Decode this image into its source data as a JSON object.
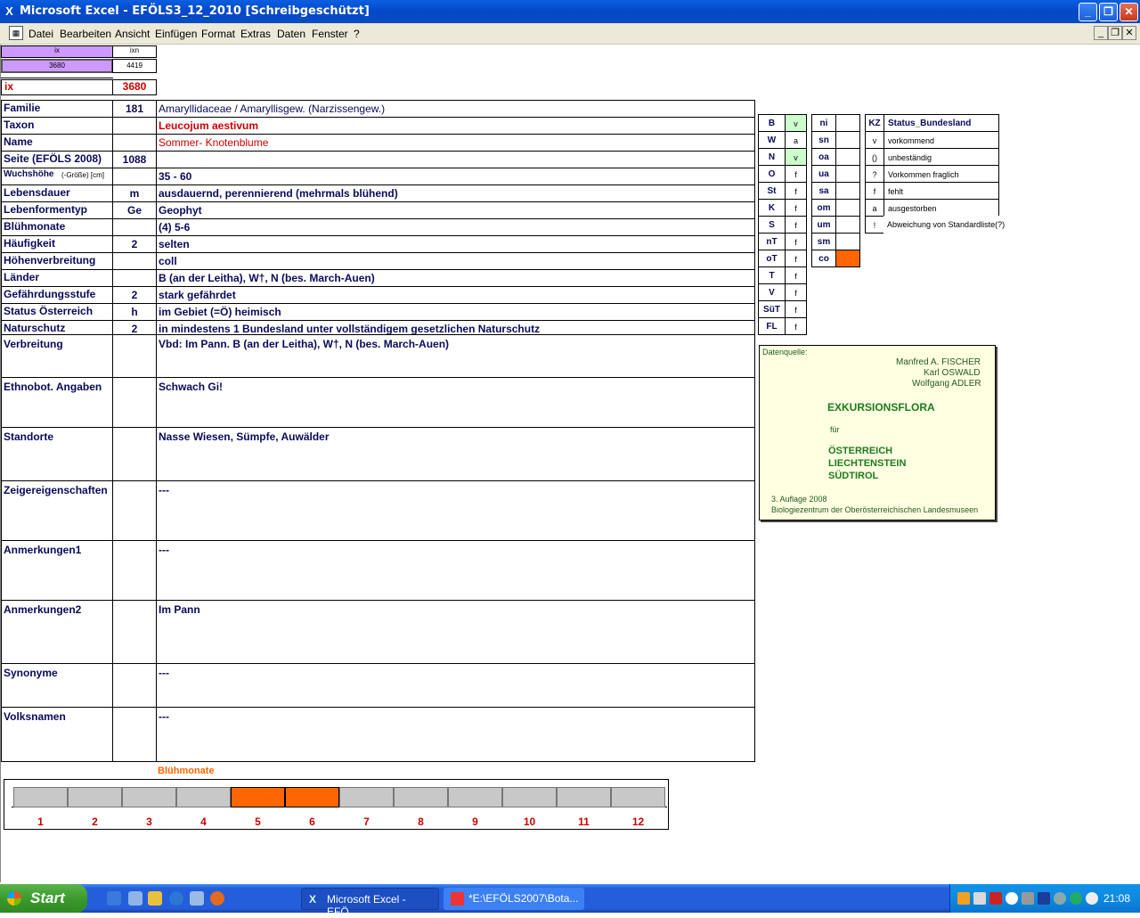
{
  "window": {
    "title": "Microsoft Excel - EFÖLS3_12_2010  [Schreibgeschützt]"
  },
  "menu": {
    "items": [
      "Datei",
      "Bearbeiten",
      "Ansicht",
      "Einfügen",
      "Format",
      "Extras",
      "Daten",
      "Fenster",
      "?"
    ]
  },
  "topcells": {
    "h1": "ix",
    "h2": "ixn",
    "v1": "3680",
    "v2": "4419",
    "ix_label": "ix",
    "ix_value": "3680"
  },
  "rows": [
    {
      "label": "Familie",
      "code": "181",
      "value": "Amaryllidaceae  /  Amaryllisgew. (Narzissengew.)"
    },
    {
      "label": "Taxon",
      "code": "",
      "value": "Leucojum aestivum"
    },
    {
      "label": "Name",
      "code": "",
      "value": "Sommer- Knotenblume"
    },
    {
      "label": "Seite (EFÖLS 2008)",
      "code": "1088",
      "value": ""
    },
    {
      "label": "Wuchshöhe",
      "label_suffix": "(-Größe) [cm]",
      "code": "",
      "value": " 35 - 60"
    },
    {
      "label": "Lebensdauer",
      "code": "m",
      "value": "ausdauernd, perennierend (mehrmals blühend)"
    },
    {
      "label": "Lebenformentyp",
      "code": "Ge",
      "value": "Geophyt"
    },
    {
      "label": "Blühmonate",
      "code": "",
      "value": "(4) 5-6"
    },
    {
      "label": "Häufigkeit",
      "code": "2",
      "value": "selten"
    },
    {
      "label": "Höhenverbreitung",
      "code": "",
      "value": "coll"
    },
    {
      "label": "Länder",
      "code": "",
      "value": "B (an der Leitha), W†, N (bes. March-Auen)"
    },
    {
      "label": "Gefährdungsstufe",
      "code": "2",
      "value": "stark gefährdet"
    },
    {
      "label": "Status Österreich",
      "code": "h",
      "value": "im Gebiet (=Ö) heimisch"
    },
    {
      "label": "Naturschutz",
      "code": "2",
      "value": "in mindestens 1 Bundesland unter vollständigem gesetzlichen Naturschutz"
    }
  ],
  "bigrows": [
    {
      "label": "Verbreitung",
      "value": "Vbd: Im Pann. B (an der Leitha), W†, N (bes. March-Auen)"
    },
    {
      "label": "Ethnobot. Angaben",
      "value": " Schwach Gi!"
    },
    {
      "label": "Standorte",
      "value": "Nasse Wiesen, Sümpfe, Auwälder"
    },
    {
      "label": "Zeigereigenschaften",
      "value": "---"
    },
    {
      "label": "Anmerkungen1",
      "value": "---"
    },
    {
      "label": "Anmerkungen2",
      "value": "Im Pann"
    },
    {
      "label": "Synonyme",
      "value": "---"
    },
    {
      "label": "Volksnamen",
      "value": "---"
    }
  ],
  "bundes": [
    {
      "code": "B",
      "st": "v",
      "green": true
    },
    {
      "code": "W",
      "st": "a",
      "green": false
    },
    {
      "code": "N",
      "st": "v",
      "green": true
    },
    {
      "code": "O",
      "st": "f",
      "green": false
    },
    {
      "code": "St",
      "st": "f",
      "green": false
    },
    {
      "code": "K",
      "st": "f",
      "green": false
    },
    {
      "code": "S",
      "st": "f",
      "green": false
    },
    {
      "code": "nT",
      "st": "f",
      "green": false
    },
    {
      "code": "oT",
      "st": "f",
      "green": false
    },
    {
      "code": "T",
      "st": "f",
      "green": false
    },
    {
      "code": "V",
      "st": "f",
      "green": false
    },
    {
      "code": "SüT",
      "st": "f",
      "green": false
    },
    {
      "code": "FL",
      "st": "f",
      "green": false
    }
  ],
  "hoehen": [
    {
      "code": "ni",
      "orange": false
    },
    {
      "code": "sn",
      "orange": false
    },
    {
      "code": "oa",
      "orange": false
    },
    {
      "code": "ua",
      "orange": false
    },
    {
      "code": "sa",
      "orange": false
    },
    {
      "code": "om",
      "orange": false
    },
    {
      "code": "um",
      "orange": false
    },
    {
      "code": "sm",
      "orange": false
    },
    {
      "code": "co",
      "orange": true
    }
  ],
  "legend": {
    "header": {
      "kz": "KZ",
      "status": "Status_Bundesland"
    },
    "items": [
      {
        "kz": "v",
        "text": "vorkommend"
      },
      {
        "kz": "()",
        "text": "unbeständig"
      },
      {
        "kz": "?",
        "text": "Vorkommen fraglich"
      },
      {
        "kz": "f",
        "text": "fehlt"
      },
      {
        "kz": "a",
        "text": "ausgestorben"
      },
      {
        "kz": "!",
        "text": "Abweichung von Standardliste(?)"
      }
    ]
  },
  "source": {
    "label": "Datenquelle:",
    "author1": "Manfred A. FISCHER",
    "author2": "Karl OSWALD",
    "author3": "Wolfgang ADLER",
    "title": "EXKURSIONSFLORA",
    "fuer": "für",
    "c1": "ÖSTERREICH",
    "c2": "LIECHTENSTEIN",
    "c3": "SÜDTIROL",
    "edition": "3. Auflage 2008",
    "publisher": "Biologiezentrum der Oberösterreichischen Landesmuseen"
  },
  "months": {
    "title": "Blühmonate",
    "labels": [
      "1",
      "2",
      "3",
      "4",
      "5",
      "6",
      "7",
      "8",
      "9",
      "10",
      "11",
      "12"
    ],
    "active": [
      5,
      6
    ],
    "active_color": "#ff6600",
    "inactive_color": "#c8c8c8"
  },
  "taskbar": {
    "start": "Start",
    "tasks": [
      "Microsoft Excel - EFÖ...",
      "*E:\\EFÖLS2007\\Bota..."
    ],
    "clock": "21:08"
  }
}
